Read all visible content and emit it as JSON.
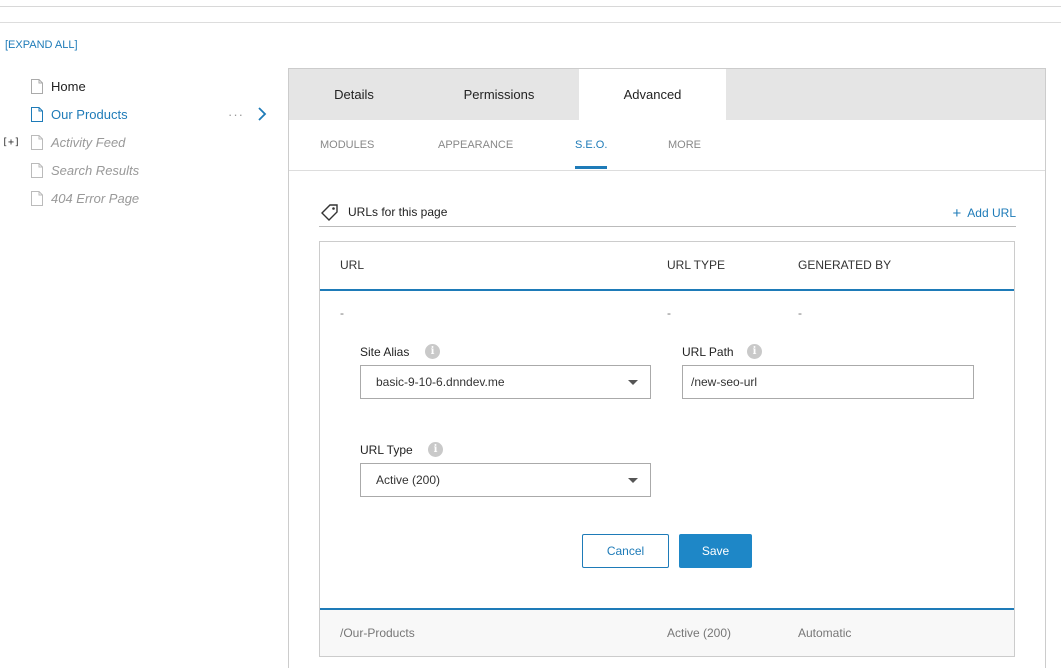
{
  "expand_all_label": "[EXPAND ALL]",
  "tree": {
    "items": [
      {
        "label": "Home",
        "state": "normal",
        "expander": ""
      },
      {
        "label": "Our Products",
        "state": "selected",
        "expander": ""
      },
      {
        "label": "Activity Feed",
        "state": "disabled",
        "expander": "[+]"
      },
      {
        "label": "Search Results",
        "state": "disabled",
        "expander": ""
      },
      {
        "label": "404 Error Page",
        "state": "disabled",
        "expander": ""
      }
    ],
    "more_dots": "···"
  },
  "tabs": [
    "Details",
    "Permissions",
    "Advanced"
  ],
  "active_tab": "Advanced",
  "subtabs": [
    "MODULES",
    "APPEARANCE",
    "S.E.O.",
    "MORE"
  ],
  "active_subtab": "S.E.O.",
  "urls": {
    "title": "URLs for this page",
    "add_label": "Add URL",
    "columns": {
      "url": "URL",
      "url_type": "URL TYPE",
      "generated_by": "GENERATED BY"
    },
    "editing_row": {
      "url": "-",
      "url_type": "-",
      "generated_by": "-"
    },
    "form": {
      "site_alias_label": "Site Alias",
      "site_alias_value": "basic-9-10-6.dnndev.me",
      "url_path_label": "URL Path",
      "url_path_value": "/new-seo-url",
      "url_type_label": "URL Type",
      "url_type_value": "Active (200)",
      "cancel_label": "Cancel",
      "save_label": "Save"
    },
    "rows": [
      {
        "url": "/Our-Products",
        "url_type": "Active (200)",
        "generated_by": "Automatic"
      }
    ]
  },
  "colors": {
    "accent": "#1e7bb8",
    "save_button": "#1e87c7",
    "tab_bar": "#e5e5e5"
  }
}
